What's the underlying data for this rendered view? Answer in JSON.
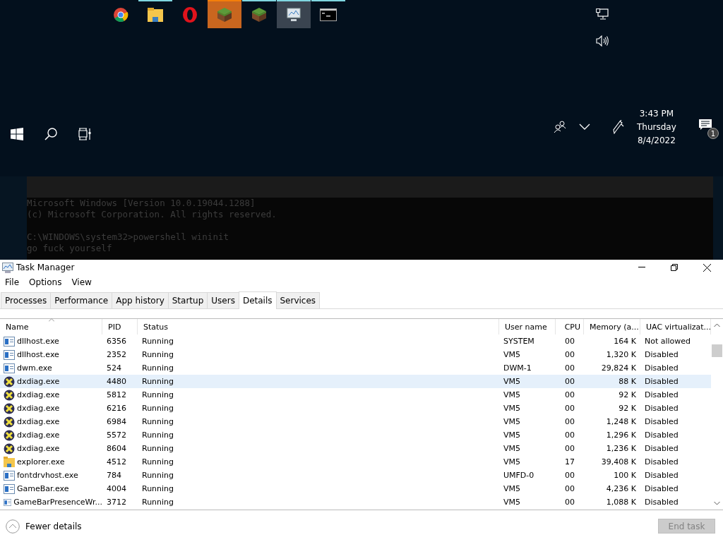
{
  "taskbar": {
    "apps": [
      {
        "kind": "chrome",
        "running": false,
        "focused": false,
        "flashing": false
      },
      {
        "kind": "folder",
        "running": true,
        "focused": false,
        "flashing": false
      },
      {
        "kind": "opera",
        "running": false,
        "focused": false,
        "flashing": false
      },
      {
        "kind": "block",
        "running": true,
        "focused": false,
        "flashing": true
      },
      {
        "kind": "block",
        "running": true,
        "focused": false,
        "flashing": false
      },
      {
        "kind": "monitor",
        "running": true,
        "focused": true,
        "flashing": false
      },
      {
        "kind": "console",
        "running": true,
        "focused": false,
        "flashing": false
      }
    ],
    "clock": {
      "time": "3:43 PM",
      "day": "Thursday",
      "date": "8/4/2022"
    },
    "notifications": {
      "count": "1"
    }
  },
  "console": {
    "blocks": [
      [
        "Microsoft Windows [Version 10.0.19044.1288]",
        "(c) Microsoft Corporation. All rights reserved."
      ],
      [
        "C:\\WINDOWS\\system32>powershell wininit",
        "go fuck yourself"
      ]
    ]
  },
  "task_manager": {
    "title": "Task Manager",
    "menu": [
      "File",
      "Options",
      "View"
    ],
    "tabs": [
      {
        "label": "Processes",
        "selected": false
      },
      {
        "label": "Performance",
        "selected": false
      },
      {
        "label": "App history",
        "selected": false
      },
      {
        "label": "Startup",
        "selected": false
      },
      {
        "label": "Users",
        "selected": false
      },
      {
        "label": "Details",
        "selected": true
      },
      {
        "label": "Services",
        "selected": false
      }
    ],
    "columns": [
      "Name",
      "PID",
      "Status",
      "User name",
      "CPU",
      "Memory (a...",
      "UAC virtualizat..."
    ],
    "rows": [
      {
        "kind": "window",
        "name": "dllhost.exe",
        "pid": "6356",
        "status": "Running",
        "user": "SYSTEM",
        "cpu": "00",
        "memory": "164 K",
        "uac": "Not allowed",
        "selected": false
      },
      {
        "kind": "window",
        "name": "dllhost.exe",
        "pid": "2352",
        "status": "Running",
        "user": "VM5",
        "cpu": "00",
        "memory": "1,320 K",
        "uac": "Disabled",
        "selected": false
      },
      {
        "kind": "window",
        "name": "dwm.exe",
        "pid": "524",
        "status": "Running",
        "user": "DWM-1",
        "cpu": "00",
        "memory": "29,824 K",
        "uac": "Disabled",
        "selected": false
      },
      {
        "kind": "dxdiag",
        "name": "dxdiag.exe",
        "pid": "4480",
        "status": "Running",
        "user": "VM5",
        "cpu": "00",
        "memory": "88 K",
        "uac": "Disabled",
        "selected": true
      },
      {
        "kind": "dxdiag",
        "name": "dxdiag.exe",
        "pid": "5812",
        "status": "Running",
        "user": "VM5",
        "cpu": "00",
        "memory": "92 K",
        "uac": "Disabled",
        "selected": false
      },
      {
        "kind": "dxdiag",
        "name": "dxdiag.exe",
        "pid": "6216",
        "status": "Running",
        "user": "VM5",
        "cpu": "00",
        "memory": "92 K",
        "uac": "Disabled",
        "selected": false
      },
      {
        "kind": "dxdiag",
        "name": "dxdiag.exe",
        "pid": "6984",
        "status": "Running",
        "user": "VM5",
        "cpu": "00",
        "memory": "1,248 K",
        "uac": "Disabled",
        "selected": false
      },
      {
        "kind": "dxdiag",
        "name": "dxdiag.exe",
        "pid": "5572",
        "status": "Running",
        "user": "VM5",
        "cpu": "00",
        "memory": "1,296 K",
        "uac": "Disabled",
        "selected": false
      },
      {
        "kind": "dxdiag",
        "name": "dxdiag.exe",
        "pid": "8604",
        "status": "Running",
        "user": "VM5",
        "cpu": "00",
        "memory": "1,236 K",
        "uac": "Disabled",
        "selected": false
      },
      {
        "kind": "explorer",
        "name": "explorer.exe",
        "pid": "4512",
        "status": "Running",
        "user": "VM5",
        "cpu": "17",
        "memory": "39,408 K",
        "uac": "Disabled",
        "selected": false
      },
      {
        "kind": "window",
        "name": "fontdrvhost.exe",
        "pid": "784",
        "status": "Running",
        "user": "UMFD-0",
        "cpu": "00",
        "memory": "100 K",
        "uac": "Disabled",
        "selected": false
      },
      {
        "kind": "window",
        "name": "GameBar.exe",
        "pid": "4004",
        "status": "Running",
        "user": "VM5",
        "cpu": "00",
        "memory": "4,236 K",
        "uac": "Disabled",
        "selected": false
      },
      {
        "kind": "window",
        "name": "GameBarPresenceWr...",
        "pid": "3712",
        "status": "Running",
        "user": "VM5",
        "cpu": "00",
        "memory": "1,088 K",
        "uac": "Disabled",
        "selected": false
      }
    ],
    "fewer_details": "Fewer details",
    "end_task": {
      "label": "End task",
      "disabled": true
    }
  }
}
